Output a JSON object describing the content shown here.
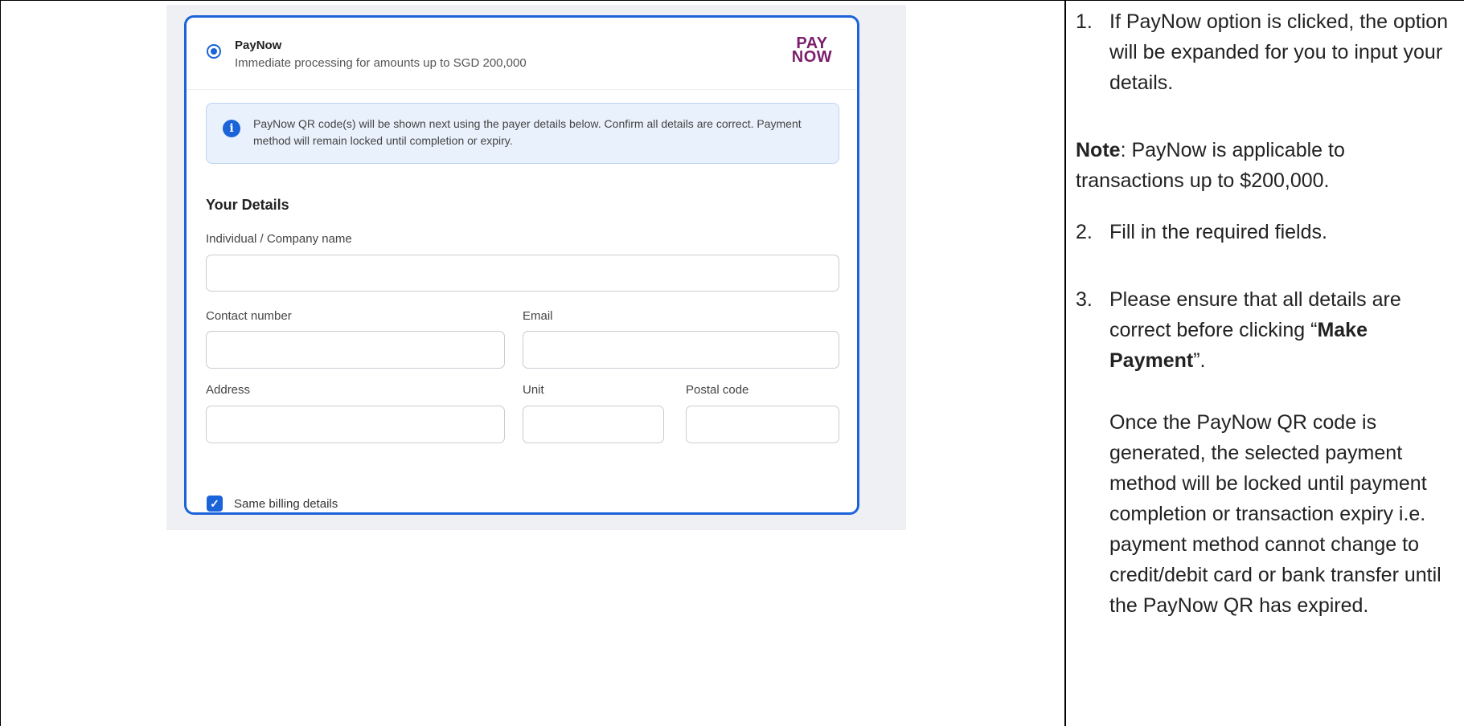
{
  "payment_option": {
    "title": "PayNow",
    "subtitle": "Immediate processing for amounts up to SGD 200,000",
    "logo_top": "PAY",
    "logo_bottom": "NOW",
    "selected": true
  },
  "info_banner": {
    "icon": "info-icon",
    "text": "PayNow QR code(s) will be shown next using the payer details below. Confirm all details are correct. Payment method will remain locked until completion or expiry."
  },
  "form": {
    "section_title": "Your Details",
    "fields": {
      "name_label": "Individual / Company name",
      "contact_label": "Contact number",
      "email_label": "Email",
      "address_label": "Address",
      "unit_label": "Unit",
      "postal_label": "Postal code"
    },
    "values": {
      "name": "",
      "contact": "",
      "email": "",
      "address": "",
      "unit": "",
      "postal": ""
    },
    "same_billing_label": "Same billing details",
    "same_billing_checked": true
  },
  "instructions": {
    "step1_num": "1.",
    "step1_text": "If PayNow option is clicked, the option will be expanded for you to input your details.",
    "note_label": "Note",
    "note_text": ": PayNow is applicable to transactions up to $200,000.",
    "step2_num": "2.",
    "step2_text": "Fill in the required fields.",
    "step3_num": "3.",
    "step3_text_before": "Please ensure that all details are correct before clicking “",
    "step3_bold": "Make Payment",
    "step3_text_after": "”.",
    "step3_followup": "Once the PayNow QR code is generated, the selected payment method will be locked until payment completion or transaction expiry i.e. payment method cannot change to credit/debit card or bank transfer until the PayNow QR has expired."
  },
  "colors": {
    "accent": "#1a63d8",
    "paynow_logo": "#7b1e6d",
    "info_bg": "#e9f1fc"
  }
}
